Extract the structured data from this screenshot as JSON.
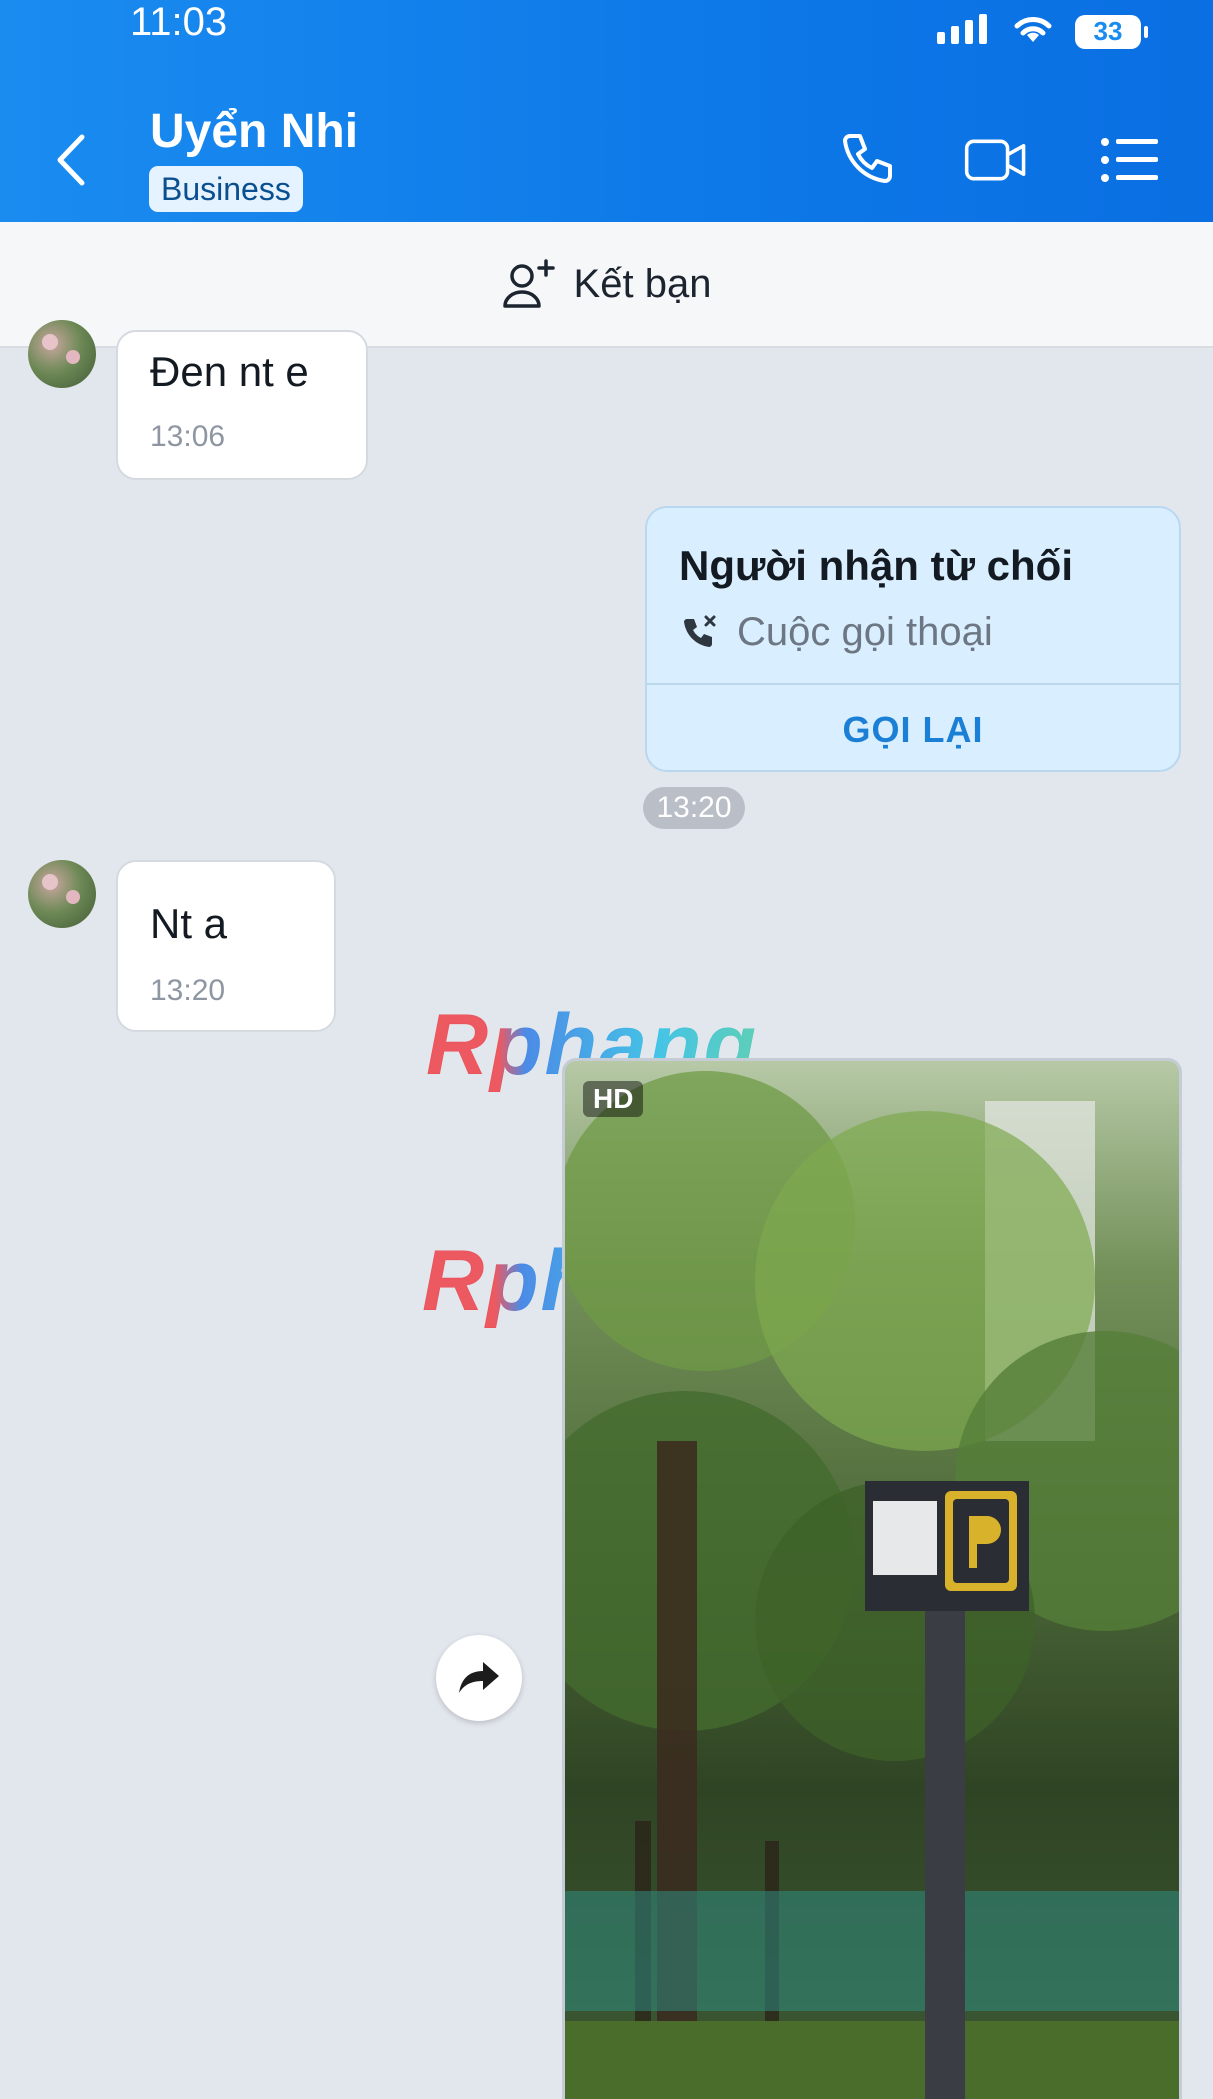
{
  "status_bar": {
    "time": "11:03",
    "battery": "33"
  },
  "header": {
    "contact_name": "Uyển Nhi",
    "badge": "Business",
    "icons": [
      "back-icon",
      "phone-icon",
      "video-icon",
      "menu-icon"
    ]
  },
  "friend_bar": {
    "label": "Kết bạn",
    "icon": "add-friend-icon"
  },
  "messages": [
    {
      "direction": "incoming",
      "text": "Đen nt e",
      "time": "13:06"
    },
    {
      "direction": "outgoing",
      "type": "call",
      "title": "Người nhận từ chối",
      "subtitle": "Cuộc gọi thoại",
      "action": "GỌI LẠI",
      "time": "13:20"
    },
    {
      "direction": "incoming",
      "text": "Nt a",
      "time": "13:20"
    },
    {
      "direction": "outgoing",
      "type": "image",
      "badge": "HD",
      "watermark": "Rphang"
    }
  ],
  "colors": {
    "header_blue": "#1a8cf0",
    "chat_bg": "#e2e6ed",
    "call_card": "#d9efff",
    "action_blue": "#1b7fd6"
  }
}
